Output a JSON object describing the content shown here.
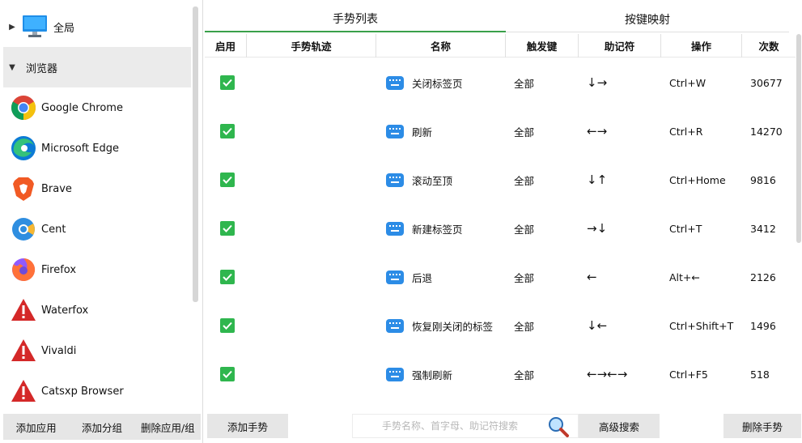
{
  "left": {
    "groups": [
      {
        "label": "全局",
        "icon": "monitor-icon",
        "arrow": "▶"
      },
      {
        "label": "浏览器",
        "arrow": "▼"
      }
    ],
    "apps": [
      {
        "label": "Google Chrome",
        "icon": "chrome-icon"
      },
      {
        "label": "Microsoft Edge",
        "icon": "edge-icon"
      },
      {
        "label": "Brave",
        "icon": "brave-icon"
      },
      {
        "label": "Cent",
        "icon": "cent-icon"
      },
      {
        "label": "Firefox",
        "icon": "firefox-icon"
      },
      {
        "label": "Waterfox",
        "icon": "warning-icon"
      },
      {
        "label": "Vivaldi",
        "icon": "warning-icon"
      },
      {
        "label": "Catsxp Browser",
        "icon": "warning-icon"
      }
    ],
    "footer": {
      "add_app": "添加应用",
      "add_group": "添加分组",
      "delete": "删除应用/组"
    }
  },
  "tabs": {
    "gesture_list": "手势列表",
    "key_mapping": "按键映射"
  },
  "table": {
    "headers": {
      "enabled": "启用",
      "track": "手势轨迹",
      "name": "名称",
      "trigger": "触发键",
      "mnemonic": "助记符",
      "action": "操作",
      "count": "次数"
    },
    "rows": [
      {
        "name": "关闭标签页",
        "trigger": "全部",
        "mnemonic": "↓→",
        "action": "Ctrl+W",
        "count": "30677"
      },
      {
        "name": "刷新",
        "trigger": "全部",
        "mnemonic": "←→",
        "action": "Ctrl+R",
        "count": "14270"
      },
      {
        "name": "滚动至顶",
        "trigger": "全部",
        "mnemonic": "↓↑",
        "action": "Ctrl+Home",
        "count": "9816"
      },
      {
        "name": "新建标签页",
        "trigger": "全部",
        "mnemonic": "→↓",
        "action": "Ctrl+T",
        "count": "3412"
      },
      {
        "name": "后退",
        "trigger": "全部",
        "mnemonic": "←",
        "action": "Alt+←",
        "count": "2126"
      },
      {
        "name": "恢复刚关闭的标签",
        "trigger": "全部",
        "mnemonic": "↓←",
        "action": "Ctrl+Shift+T",
        "count": "1496"
      },
      {
        "name": "强制刷新",
        "trigger": "全部",
        "mnemonic": "←→←→",
        "action": "Ctrl+F5",
        "count": "518"
      }
    ]
  },
  "bottom": {
    "add_gesture": "添加手势",
    "search_placeholder": "手势名称、首字母、助记符搜索",
    "advanced_search": "高级搜索",
    "delete_gesture": "删除手势"
  },
  "colors": {
    "accent_green": "#3aa04a",
    "check_green": "#2fb64e",
    "keyboard_blue": "#2c8ce6",
    "warning_red": "#d42828"
  }
}
